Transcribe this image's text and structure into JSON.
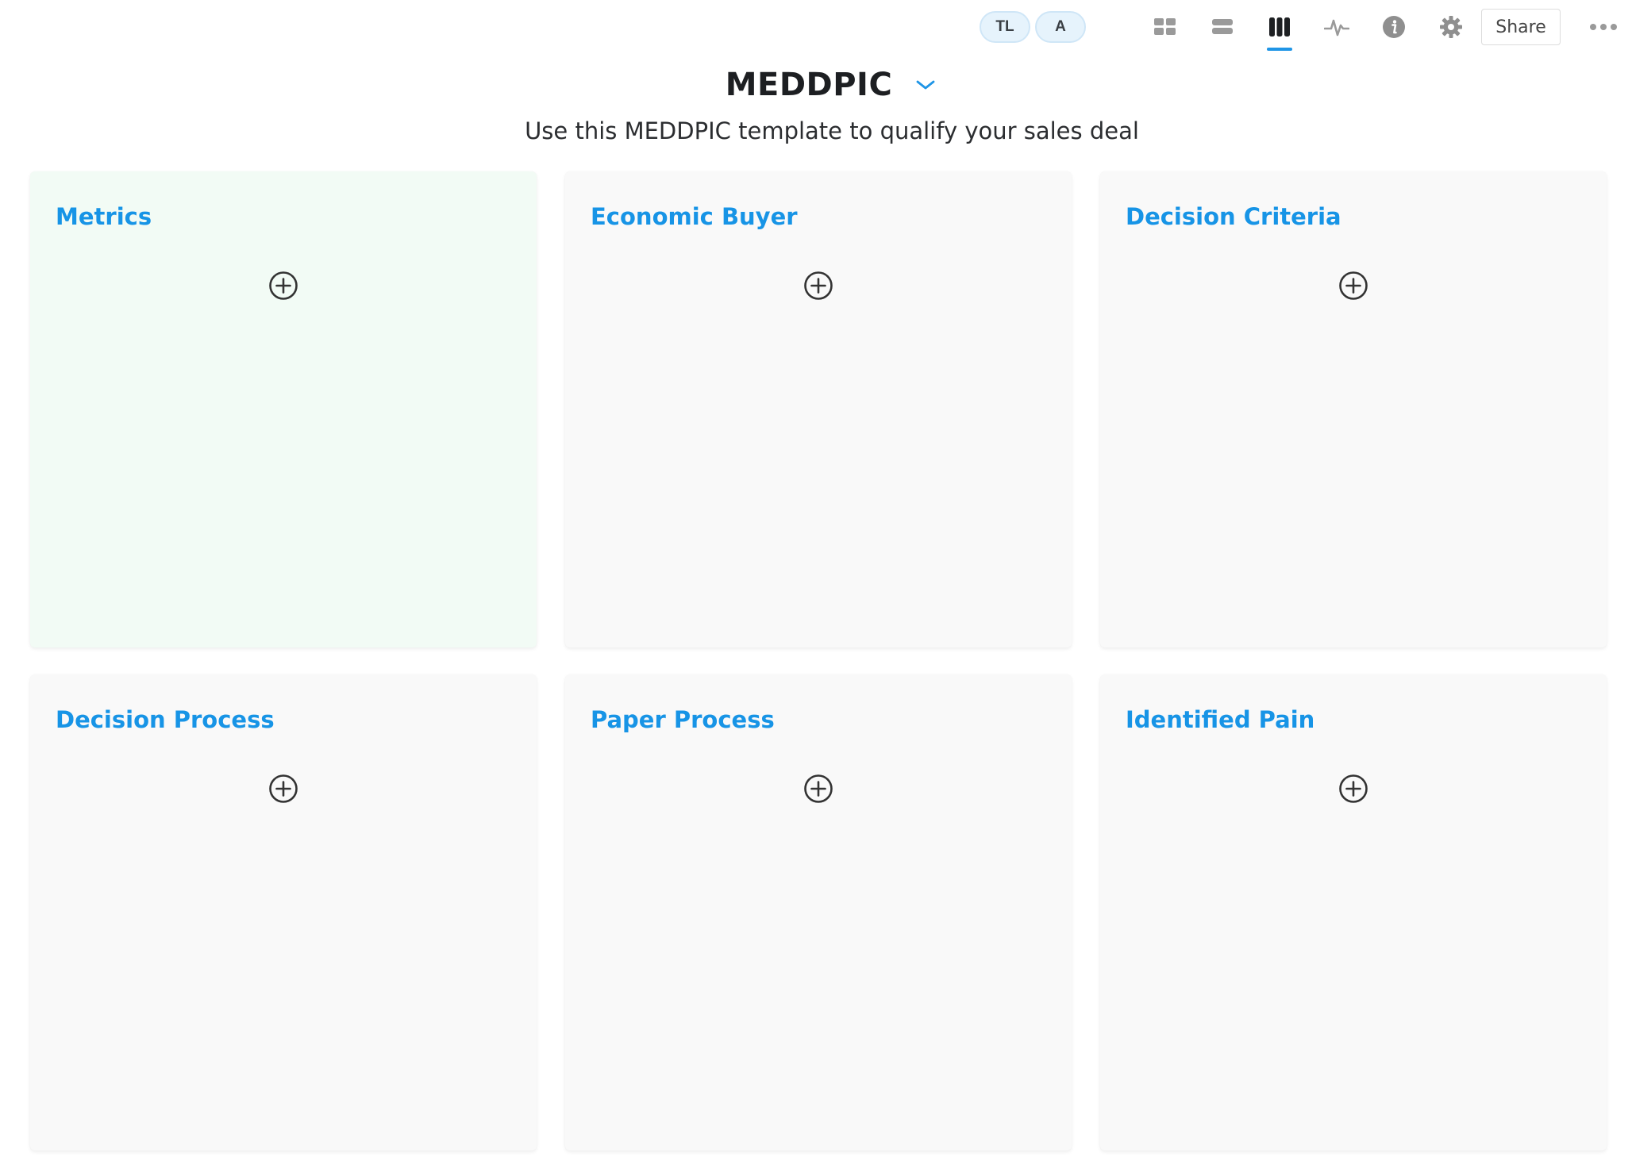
{
  "topbar": {
    "avatars": [
      {
        "initials": "TL"
      },
      {
        "initials": "A"
      }
    ],
    "view_icons": [
      "grid-view-icon",
      "list-view-icon",
      "columns-view-icon",
      "activity-icon",
      "info-icon",
      "gear-icon"
    ],
    "active_view": "columns-view-icon",
    "share_label": "Share",
    "accent_color": "#1f95e6"
  },
  "header": {
    "title": "MEDDPIC",
    "subtitle": "Use this MEDDPIC template to qualify your sales deal"
  },
  "cards": [
    {
      "title": "Metrics"
    },
    {
      "title": "Economic Buyer"
    },
    {
      "title": "Decision Criteria"
    },
    {
      "title": "Decision Process"
    },
    {
      "title": "Paper Process"
    },
    {
      "title": "Identified Pain"
    }
  ],
  "colors": {
    "card_title": "#1794e6",
    "card_bg": "#f9f9f9",
    "card_bg_highlight": "#f2fbf5"
  }
}
